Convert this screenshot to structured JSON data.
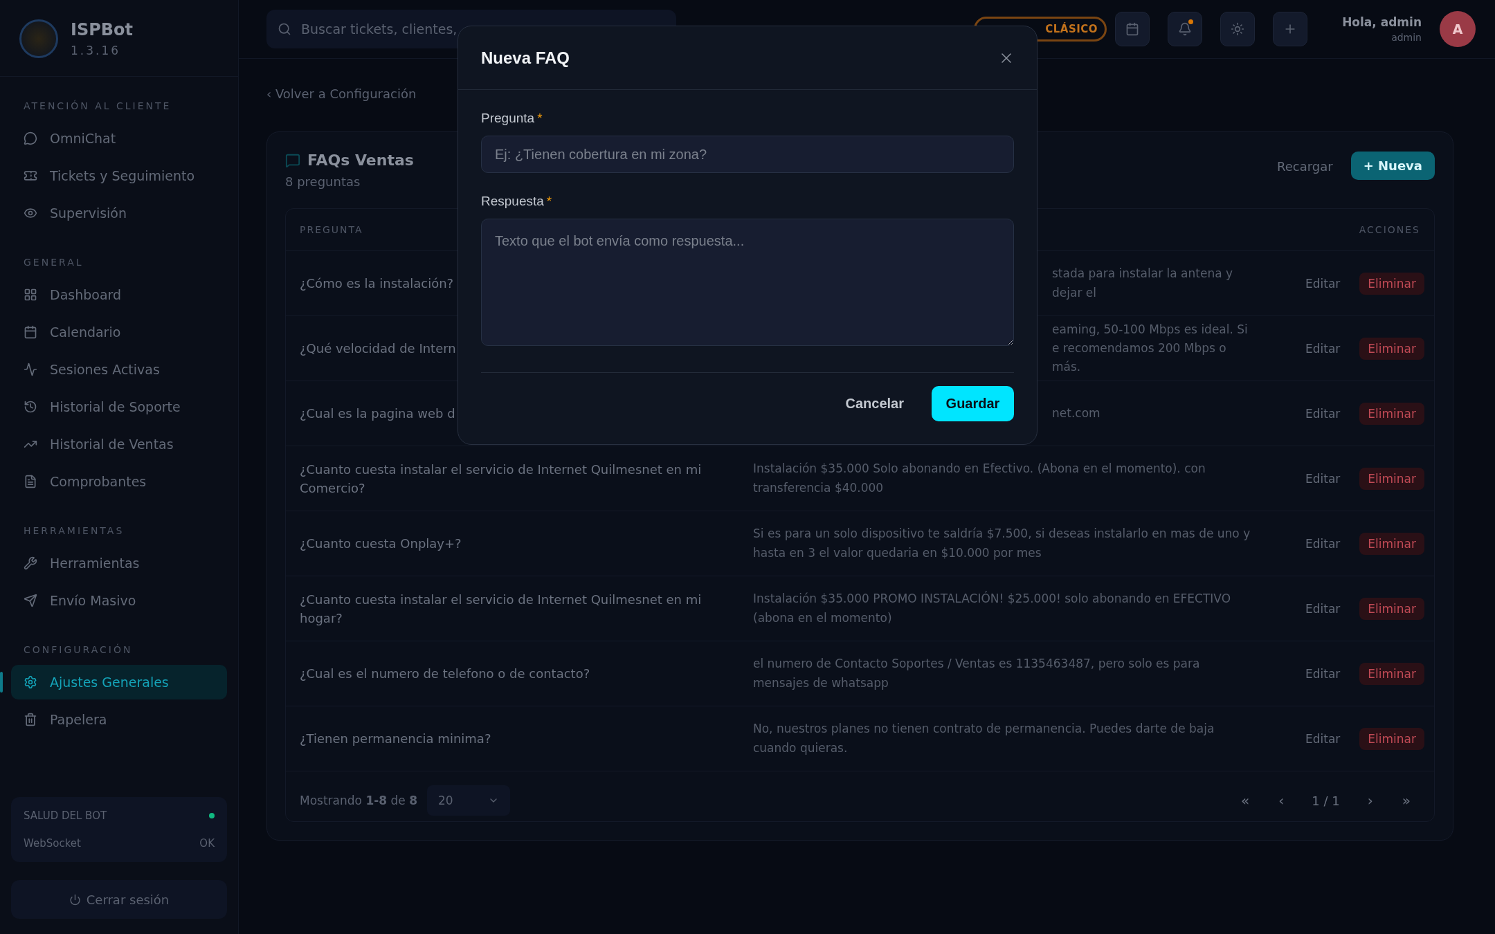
{
  "sidebar": {
    "brand": "ISPBot",
    "version": "1.3.16",
    "sections": [
      {
        "title": "ATENCIÓN AL CLIENTE",
        "items": [
          {
            "label": "OmniChat",
            "selected": false
          },
          {
            "label": "Tickets y Seguimiento",
            "selected": false
          },
          {
            "label": "Supervisión",
            "selected": false
          }
        ]
      },
      {
        "title": "GENERAL",
        "items": [
          {
            "label": "Dashboard",
            "selected": false
          },
          {
            "label": "Calendario",
            "selected": false
          },
          {
            "label": "Sesiones Activas",
            "selected": false
          },
          {
            "label": "Historial de Soporte",
            "selected": false
          },
          {
            "label": "Historial de Ventas",
            "selected": false
          },
          {
            "label": "Comprobantes",
            "selected": false
          }
        ]
      },
      {
        "title": "HERRAMIENTAS",
        "items": [
          {
            "label": "Herramientas",
            "selected": false
          },
          {
            "label": "Envío Masivo",
            "selected": false
          }
        ]
      },
      {
        "title": "CONFIGURACIÓN",
        "items": [
          {
            "label": "Ajustes Generales",
            "selected": true
          },
          {
            "label": "Papelera",
            "selected": false
          }
        ]
      }
    ],
    "health": {
      "title": "SALUD DEL BOT",
      "color": "#10b981",
      "rows": [
        {
          "label": "WebSocket",
          "value": "OK"
        }
      ]
    },
    "logout": "Cerrar sesión"
  },
  "header": {
    "search_placeholder": "Buscar tickets, clientes,",
    "mode_badge": "CLÁSICO",
    "notification_dot": true,
    "greeting": "Hola, admin",
    "role": "admin",
    "avatar": "A"
  },
  "breadcrumb": "‹ Volver a Configuración",
  "card": {
    "title": "FAQs Ventas",
    "subtitle": "8 preguntas",
    "reload": "Recargar",
    "new": "+ Nueva",
    "columns": [
      "PREGUNTA",
      "ACCIONES"
    ],
    "rows": [
      {
        "question": "¿Cómo es la instalación?",
        "answer": "stada para instalar la antena y dejar el",
        "covered": true
      },
      {
        "question": "¿Qué velocidad de Intern",
        "answer": "eaming, 50-100 Mbps es ideal. Si e recomendamos 200 Mbps o más.",
        "covered": true
      },
      {
        "question": "¿Cual es la pagina web d",
        "answer": "net.com",
        "covered": true
      },
      {
        "question": "¿Cuanto cuesta instalar el servicio de Internet Quilmesnet en mi Comercio?",
        "answer": "Instalación $35.000 Solo abonando en Efectivo. (Abona en el momento). con transferencia $40.000",
        "covered": false
      },
      {
        "question": "¿Cuanto cuesta Onplay+?",
        "answer": "Si es para un solo dispositivo te saldría $7.500, si deseas instalarlo en mas de uno y hasta en 3 el valor quedaria en $10.000 por mes",
        "covered": false
      },
      {
        "question": "¿Cuanto cuesta instalar el servicio de Internet Quilmesnet en mi hogar?",
        "answer": "Instalación $35.000 PROMO INSTALACIÓN! $25.000! solo abonando en EFECTIVO (abona en el momento)",
        "covered": false
      },
      {
        "question": "¿Cual es el numero de telefono o de contacto?",
        "answer": "el numero de Contacto Soportes / Ventas es 1135463487, pero solo es para mensajes de whatsapp",
        "covered": false
      },
      {
        "question": "¿Tienen permanencia minima?",
        "answer": "No, nuestros planes no tienen contrato de permanencia. Puedes darte de baja cuando quieras.",
        "covered": false
      }
    ],
    "actions": [
      {
        "edit": "Editar",
        "delete": "Eliminar"
      },
      {
        "edit": "Editar",
        "delete": "Eliminar"
      },
      {
        "edit": "Editar",
        "delete": "Eliminar"
      },
      {
        "edit": "Editar",
        "delete": "Eliminar"
      },
      {
        "edit": "Editar",
        "delete": "Eliminar"
      },
      {
        "edit": "Editar",
        "delete": "Eliminar"
      },
      {
        "edit": "Editar",
        "delete": "Eliminar"
      },
      {
        "edit": "Editar",
        "delete": "Eliminar"
      }
    ],
    "footer": {
      "showing": "Mostrando **1-8** de **8**",
      "page_size": "20",
      "first": "«",
      "prev": "‹",
      "page": "1 / 1",
      "next": "›",
      "last": "»"
    }
  },
  "modal": {
    "title": "Nueva FAQ",
    "fields": [
      {
        "label": "Pregunta",
        "required": true,
        "required_mark": "*",
        "kind": "input",
        "placeholder": "Ej: ¿Tienen cobertura en mi zona?"
      },
      {
        "label": "Respuesta",
        "required": true,
        "required_mark": "*",
        "kind": "textarea",
        "placeholder": "Texto que el bot envía como respuesta..."
      }
    ],
    "cancel": "Cancelar",
    "save": "Guardar"
  }
}
